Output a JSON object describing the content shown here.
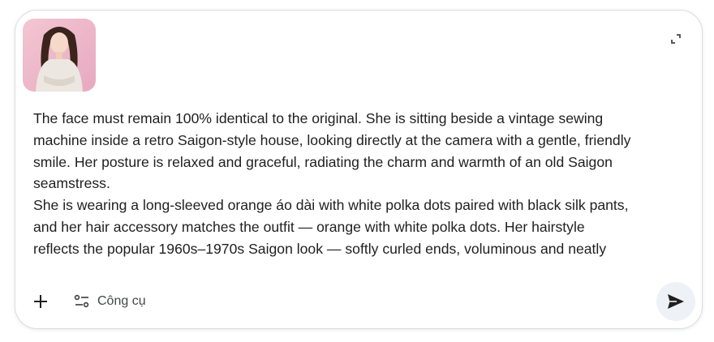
{
  "composer": {
    "attachment": {
      "kind": "image-thumbnail",
      "description_icon": "portrait-photo-icon"
    },
    "prompt_lines": [
      "The face must remain 100% identical to the original. She is sitting beside a vintage sewing",
      "machine inside a retro Saigon-style house, looking directly at the camera with a gentle, friendly",
      "smile. Her posture is relaxed and graceful, radiating the charm and warmth of an old Saigon",
      "seamstress.",
      "She is wearing a long-sleeved orange áo dài with white polka dots paired with black silk pants,",
      "and her hair accessory matches the outfit — orange with white polka dots. Her hairstyle",
      "reflects the popular 1960s–1970s Saigon look — softly curled ends, voluminous and neatly"
    ],
    "expand_icon": "expand-icon",
    "toolbar": {
      "add_icon": "plus-icon",
      "tools_icon": "tune-icon",
      "tools_label": "Công cụ",
      "send_icon": "send-icon"
    }
  },
  "colors": {
    "text": "#1f1f1f",
    "border": "#dcdde0",
    "send_bg": "#eef1f6",
    "icon": "#444746"
  }
}
